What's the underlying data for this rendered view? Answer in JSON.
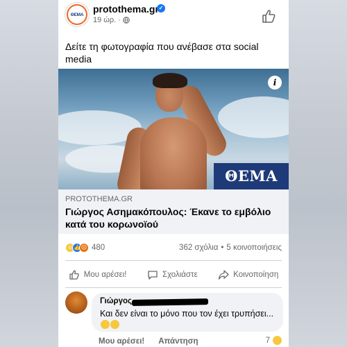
{
  "post": {
    "page_name": "protothema.gr",
    "time": "19 ώρ.",
    "separator": "·",
    "text": "Δείτε τη φωτογραφία που ανέβασε στα social media",
    "image_badge": "ΘΕΜΑ",
    "logo_text": "ΘΕΜΑ"
  },
  "link": {
    "domain": "PROTOTHEMA.GR",
    "title": "Γιώργος Ασημακόπουλος: Έκανε το εμβόλιο κατά του κορωνοϊού"
  },
  "stats": {
    "reaction_count": "480",
    "comments": "362 σχόλια",
    "dot": "•",
    "shares": "5 κοινοποιήσεις"
  },
  "actions": {
    "like": "Μου αρέσει!",
    "comment": "Σχολιάστε",
    "share": "Κοινοποίηση"
  },
  "comment": {
    "author": "Γιώργος",
    "text": "Και δεν είναι το μόνο που τον έχει τρυπήσει...",
    "like": "Μου αρέσει!",
    "reply": "Απάντηση",
    "reaction_count": "7"
  },
  "icons": {
    "verified": "verified-badge-icon",
    "globe": "globe-icon",
    "like_page": "thumbs-up-icon",
    "info": "info-icon"
  },
  "colors": {
    "accent": "#1877f2",
    "brand_navy": "#1e3a78",
    "brand_orange": "#f26522"
  }
}
